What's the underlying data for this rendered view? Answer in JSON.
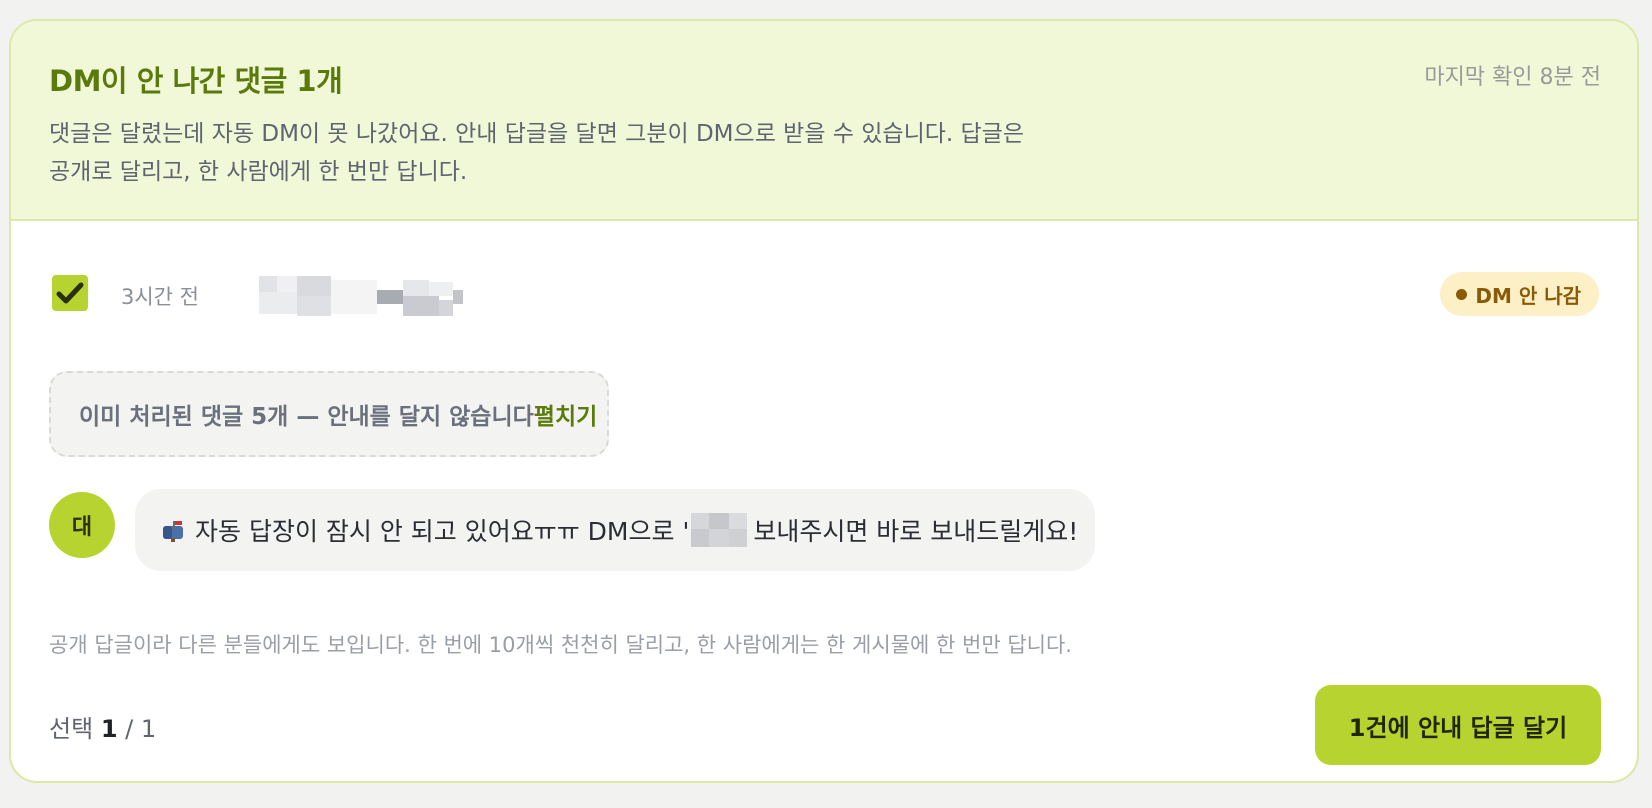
{
  "header": {
    "title": "DM이 안 나간 댓글 1개",
    "last_checked": "마지막 확인 8분 전",
    "description": "댓글은 달렸는데 자동 DM이 못 나갔어요. 안내 답글을 달면 그분이 DM으로 받을 수 있습니다. 답글은 공개로 달리고, 한 사람에게 한 번만 답니다."
  },
  "comment_row": {
    "checked": true,
    "time": "3시간 전",
    "status_badge": "DM 안 나감",
    "status_color": "#8a5a06",
    "status_bg": "#fdf0c6"
  },
  "processed": {
    "text": "이미 처리된 댓글 5개 — 안내를 달지 않습니다",
    "expand_label": "펼치기"
  },
  "reply": {
    "avatar_label": "대",
    "icon": "mailbox-icon",
    "text_before": "자동 답장이 잠시 안 되고 있어요ㅠㅠ DM으로 '",
    "text_after": " 보내주시면 바로 보내드릴게요!"
  },
  "footnote": "공개 답글이라 다른 분들에게도 보입니다. 한 번에 10개씩 천천히 달리고, 한 사람에게는 한 게시물에 한 번만 답니다.",
  "selection": {
    "label": "선택",
    "selected": "1",
    "total": "/ 1"
  },
  "submit_label": "1건에 안내 답글 달기",
  "colors": {
    "accent": "#b7d32f",
    "title_green": "#5c7a0b",
    "header_bg": "#f1f8d8"
  }
}
